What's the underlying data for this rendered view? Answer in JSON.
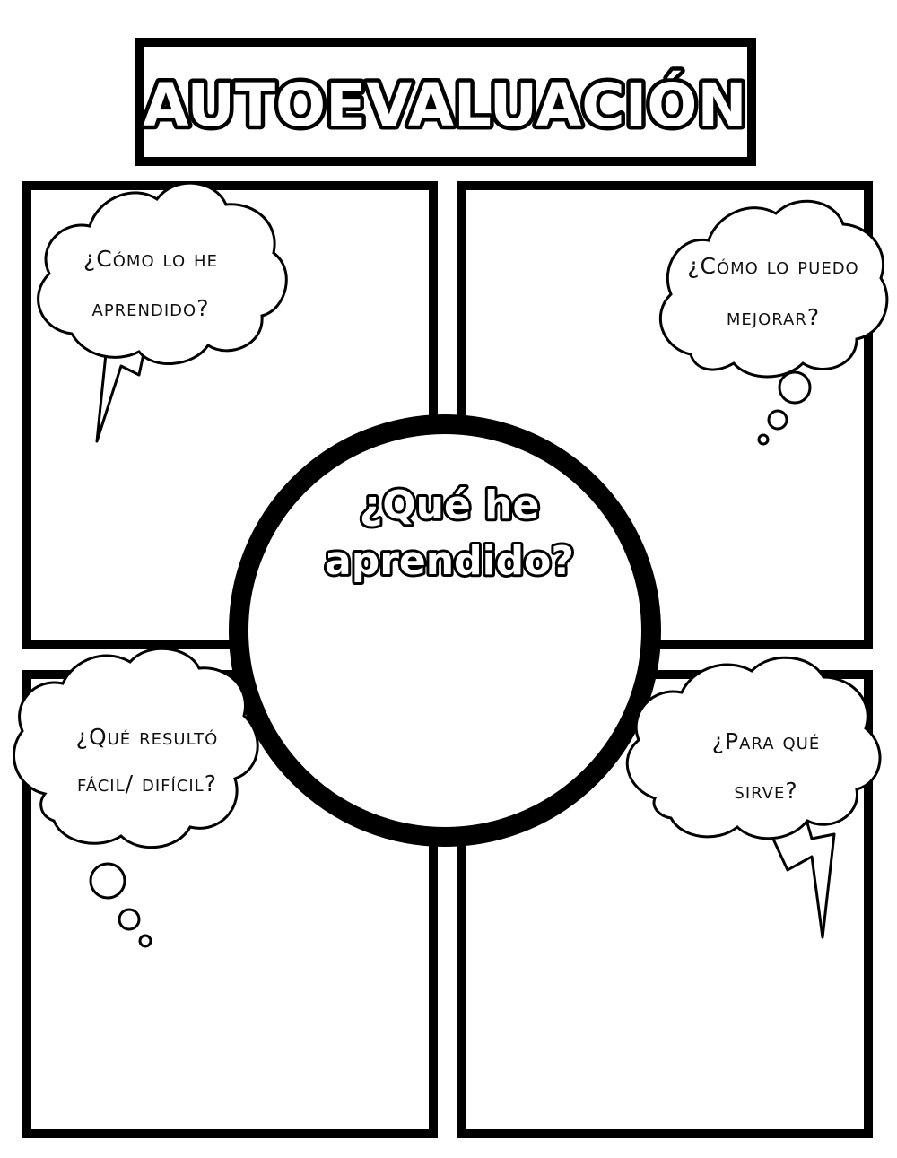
{
  "title": "AUTOEVALUACIÓN",
  "center": {
    "line1": "¿Qué he",
    "line2": "aprendido?"
  },
  "questions": {
    "top_left": {
      "line1": "¿Cómo lo he",
      "line2": "aprendido?"
    },
    "top_right": {
      "line1": "¿Cómo lo puedo",
      "line2": "mejorar?"
    },
    "bottom_left": {
      "line1": "¿Qué resultó",
      "line2": "fácil/ difícil?"
    },
    "bottom_right": {
      "line1": "¿Para qué",
      "line2": "sirve?"
    }
  },
  "colors": {
    "ink": "#000000",
    "paper": "#ffffff"
  }
}
